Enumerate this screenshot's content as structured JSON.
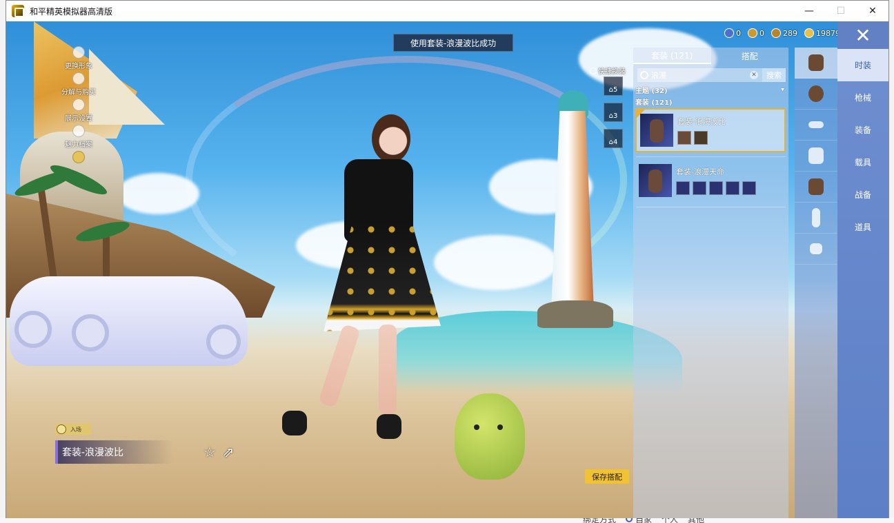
{
  "window": {
    "title": "和平精英模拟器高清版",
    "controls": {
      "minimize": "—",
      "maximize": "☐",
      "close": "✕"
    }
  },
  "toast": {
    "text": "使用套装-浪漫波比成功"
  },
  "side_menu": [
    {
      "label": "更换形象",
      "icon": "person-icon"
    },
    {
      "label": "分解与购买",
      "icon": "recycle-icon"
    },
    {
      "label": "展示设置",
      "icon": "eye-icon"
    },
    {
      "label": "魅力档案",
      "icon": "fire-icon"
    },
    {
      "label": "",
      "icon": "badge-icon"
    }
  ],
  "currency": [
    {
      "value": "0",
      "icon": "globe-coin-icon",
      "color": "#4b6fd1"
    },
    {
      "value": "0",
      "icon": "token-coin-icon",
      "color": "#c99a2e"
    },
    {
      "value": "289",
      "icon": "bronze-coin-icon",
      "color": "#b8862a"
    },
    {
      "value": "19879",
      "icon": "gold-coin-icon",
      "color": "#e8c045"
    }
  ],
  "quick_change": {
    "label": "快捷换装",
    "slots": [
      "5",
      "3",
      "4"
    ]
  },
  "panel": {
    "tabs": [
      {
        "label": "套装 (121)",
        "active": true
      },
      {
        "label": "搭配",
        "active": false
      }
    ],
    "search": {
      "value": "浪漫",
      "button": "搜索"
    },
    "filter_theme": "主题 (32)",
    "filter_suits": "套装 (121)",
    "suits": [
      {
        "name": "套装-浪漫波比",
        "selected": true
      },
      {
        "name": "套装-浪漫天命",
        "selected": false
      }
    ]
  },
  "nav": [
    {
      "label": "时装",
      "active": true
    },
    {
      "label": "枪械",
      "active": false
    },
    {
      "label": "装备",
      "active": false
    },
    {
      "label": "载具",
      "active": false
    },
    {
      "label": "战备",
      "active": false
    },
    {
      "label": "道具",
      "active": false
    }
  ],
  "category_icons": [
    "outfit-icon",
    "backpack-icon",
    "goggles-icon",
    "mask-icon",
    "top-icon",
    "pants-icon",
    "socks-icon"
  ],
  "bottom": {
    "badge_label": "入场",
    "suit_name": "套装-浪漫波比",
    "save_button": "保存搭配"
  },
  "behind_window": {
    "label": "绑定方式",
    "options": [
      "自家",
      "个人",
      "其他"
    ]
  },
  "colors": {
    "accent": "#f1c232",
    "nav_bg": "#6f8fd0",
    "selected_border": "#e6b33a"
  }
}
